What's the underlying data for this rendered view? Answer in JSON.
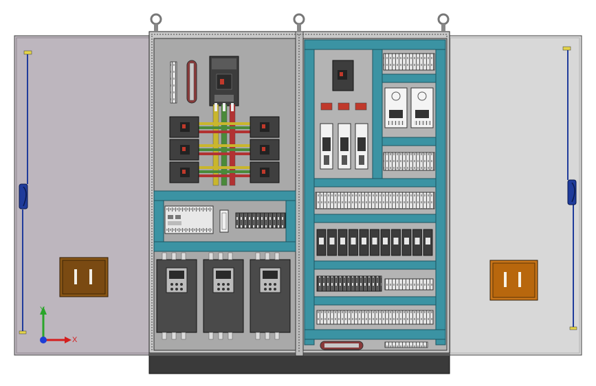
{
  "axes": {
    "x_label": "X",
    "y_label": "Y"
  },
  "colors": {
    "background": "#ffffff",
    "left_door": "#bdb6be",
    "right_door": "#d8d8d8",
    "backplate": "#a9a9a9",
    "duct": "#3b93a3",
    "base": "#3a3a3a",
    "handle": "#1f3b9b",
    "vent": "#7a4a12",
    "drive_body": "#4a4a4a",
    "busbar_yellow": "#c9b62d",
    "busbar_green": "#4a8a3a",
    "busbar_red": "#b23232",
    "axis_x": "#d41e1e",
    "axis_y": "#2aa52a",
    "axis_origin": "#1d3ed6"
  },
  "icons": [
    "lifting-eye-icon",
    "door-handle-icon",
    "ventilation-grille-icon",
    "coordinate-triad-icon"
  ],
  "components": {
    "variable_frequency_drives": 3,
    "circuit_breakers_per_side": 3,
    "relay_modules": 11
  }
}
